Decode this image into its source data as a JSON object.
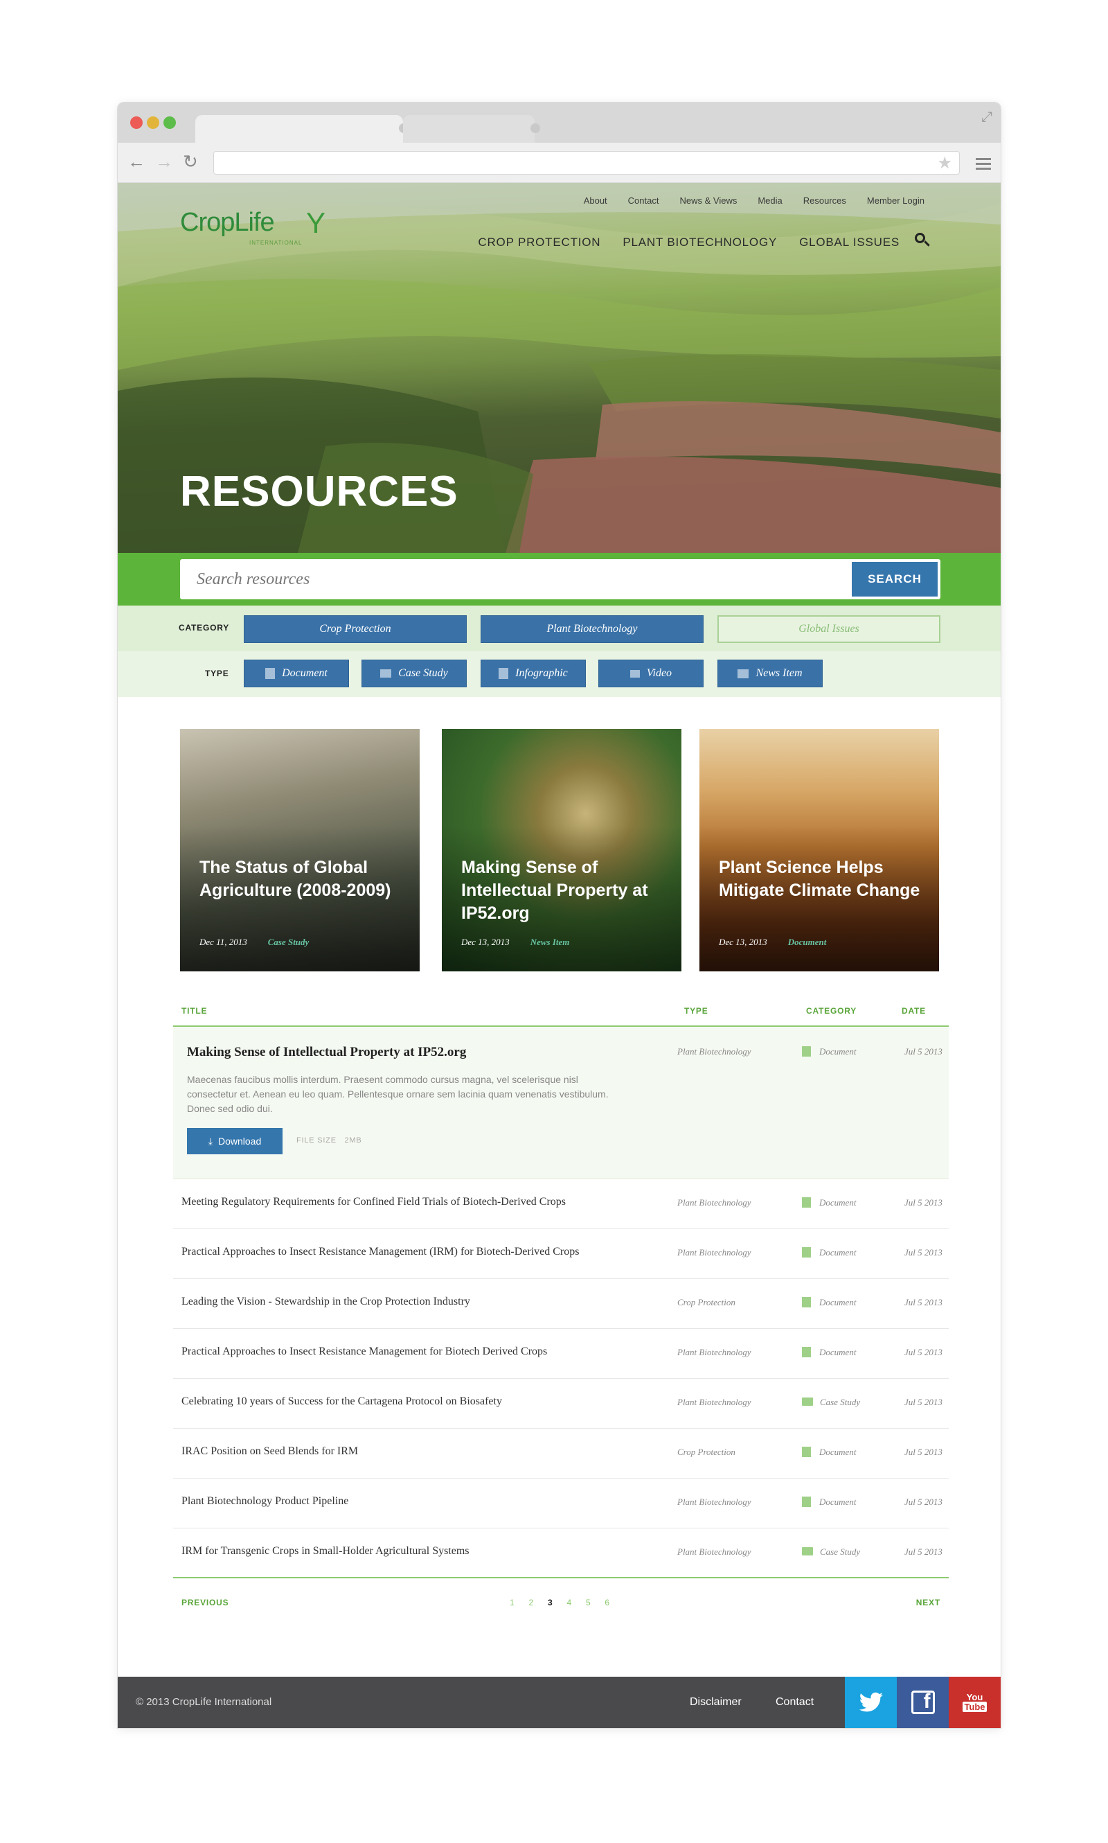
{
  "brand": {
    "name": "CropLife",
    "sub": "INTERNATIONAL",
    "green": "#5db43a",
    "blue": "#3576ad"
  },
  "util_nav": [
    "About",
    "Contact",
    "News & Views",
    "Media",
    "Resources",
    "Member Login"
  ],
  "main_nav": [
    "CROP PROTECTION",
    "PLANT BIOTECHNOLOGY",
    "GLOBAL ISSUES"
  ],
  "hero": {
    "title": "RESOURCES"
  },
  "search": {
    "placeholder": "Search resources",
    "button": "SEARCH"
  },
  "filters": {
    "category_label": "CATEGORY",
    "categories": [
      {
        "label": "Crop Protection",
        "active": true
      },
      {
        "label": "Plant Biotechnology",
        "active": true
      },
      {
        "label": "Global Issues",
        "active": false
      }
    ],
    "type_label": "TYPE",
    "types": [
      {
        "label": "Document",
        "icon": "document-icon"
      },
      {
        "label": "Case Study",
        "icon": "folder-icon"
      },
      {
        "label": "Infographic",
        "icon": "infographic-icon"
      },
      {
        "label": "Video",
        "icon": "video-icon"
      },
      {
        "label": "News Item",
        "icon": "news-icon"
      }
    ]
  },
  "featured": [
    {
      "title": "The Status of Global Agriculture (2008-2009)",
      "date": "Dec 11, 2013",
      "type": "Case Study"
    },
    {
      "title": "Making Sense of Intellectual Property at IP52.org",
      "date": "Dec 13, 2013",
      "type": "News Item"
    },
    {
      "title": "Plant Science Helps Mitigate Climate Change",
      "date": "Dec 13, 2013",
      "type": "Document"
    }
  ],
  "table": {
    "headers": {
      "title": "TITLE",
      "type": "TYPE",
      "category": "CATEGORY",
      "date": "DATE"
    },
    "expanded": {
      "title": "Making Sense of Intellectual Property at IP52.org",
      "description": "Maecenas faucibus mollis interdum. Praesent commodo cursus magna, vel scelerisque nisl consectetur et. Aenean eu leo quam. Pellentesque ornare sem lacinia quam venenatis vestibulum. Donec sed odio dui.",
      "type": "Plant Biotechnology",
      "category": "Document",
      "date": "Jul 5 2013",
      "download_label": "Download",
      "file_size_label": "FILE SIZE",
      "file_size": "2MB"
    },
    "rows": [
      {
        "title": "Meeting Regulatory Requirements for Confined Field Trials of Biotech-Derived Crops",
        "type": "Plant Biotechnology",
        "category": "Document",
        "date": "Jul 5 2013",
        "icon": "document-icon"
      },
      {
        "title": "Practical Approaches to Insect Resistance Management (IRM) for Biotech-Derived Crops",
        "type": "Plant Biotechnology",
        "category": "Document",
        "date": "Jul 5 2013",
        "icon": "document-icon"
      },
      {
        "title": "Leading the Vision - Stewardship in the Crop Protection Industry",
        "type": "Crop Protection",
        "category": "Document",
        "date": "Jul 5 2013",
        "icon": "document-icon"
      },
      {
        "title": "Practical Approaches to Insect Resistance Management for Biotech Derived Crops",
        "type": "Plant Biotechnology",
        "category": "Document",
        "date": "Jul 5 2013",
        "icon": "document-icon"
      },
      {
        "title": "Celebrating 10 years of Success for the Cartagena Protocol on Biosafety",
        "type": "Plant Biotechnology",
        "category": "Case Study",
        "date": "Jul 5 2013",
        "icon": "folder-icon"
      },
      {
        "title": "IRAC Position on Seed Blends for IRM",
        "type": "Crop Protection",
        "category": "Document",
        "date": "Jul 5 2013",
        "icon": "document-icon"
      },
      {
        "title": "Plant Biotechnology Product Pipeline",
        "type": "Plant Biotechnology",
        "category": "Document",
        "date": "Jul 5 2013",
        "icon": "document-icon"
      },
      {
        "title": "IRM for Transgenic Crops in Small-Holder Agricultural Systems",
        "type": "Plant Biotechnology",
        "category": "Case Study",
        "date": "Jul 5 2013",
        "icon": "folder-icon"
      }
    ]
  },
  "pagination": {
    "previous": "PREVIOUS",
    "next": "NEXT",
    "pages": [
      "1",
      "2",
      "3",
      "4",
      "5",
      "6"
    ],
    "current": "3"
  },
  "footer": {
    "copyright": "© 2013 CropLife International",
    "links": [
      "Disclaimer",
      "Contact"
    ],
    "social": {
      "twitter": "twitter-icon",
      "facebook": "facebook-icon",
      "youtube_line1": "You",
      "youtube_line2": "Tube"
    }
  }
}
